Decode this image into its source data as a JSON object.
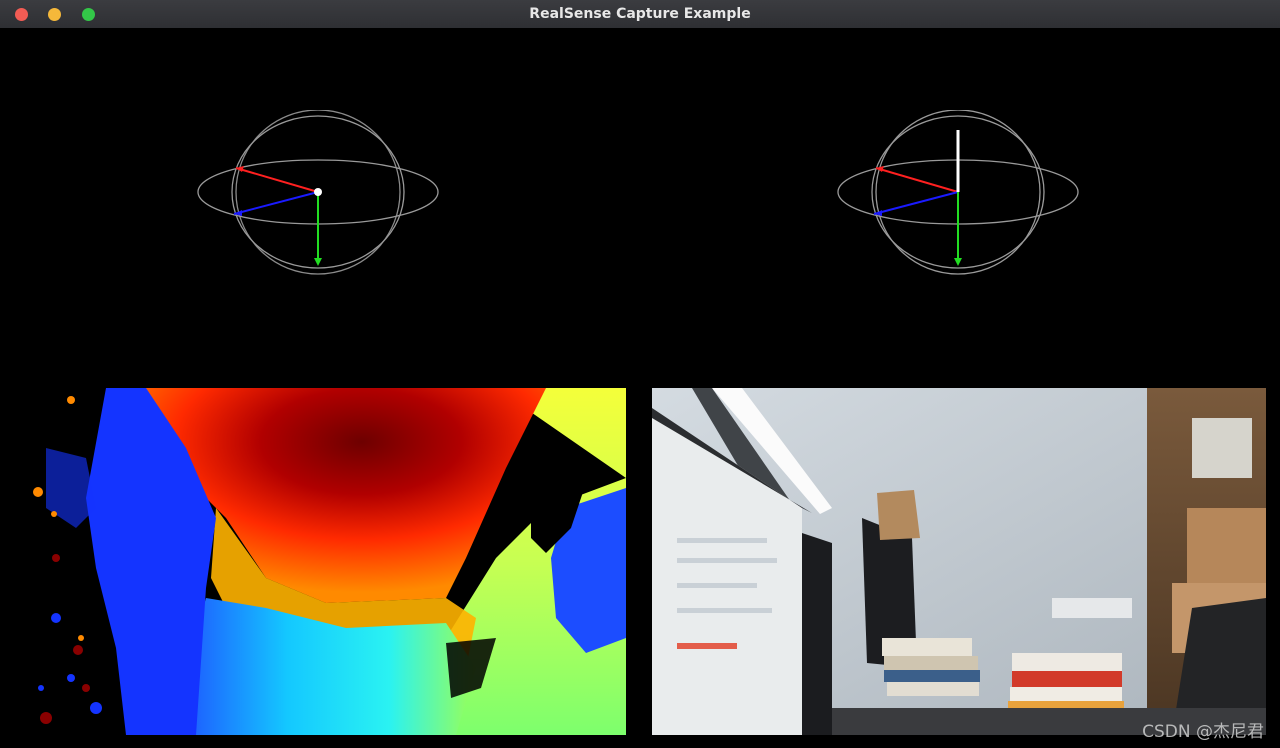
{
  "window": {
    "title": "RealSense Capture Example"
  },
  "watermark": "CSDN @杰尼君",
  "panels": {
    "gyro_left": {
      "name": "pose-gyro"
    },
    "gyro_right": {
      "name": "pose-accel"
    },
    "depth": {
      "name": "depth-stream"
    },
    "color": {
      "name": "color-stream"
    }
  },
  "colors": {
    "axis_x": "#ff2020",
    "axis_y": "#22dd22",
    "axis_z": "#1a1aff",
    "ring": "#9a9a9a",
    "vector": "#ffffff"
  }
}
